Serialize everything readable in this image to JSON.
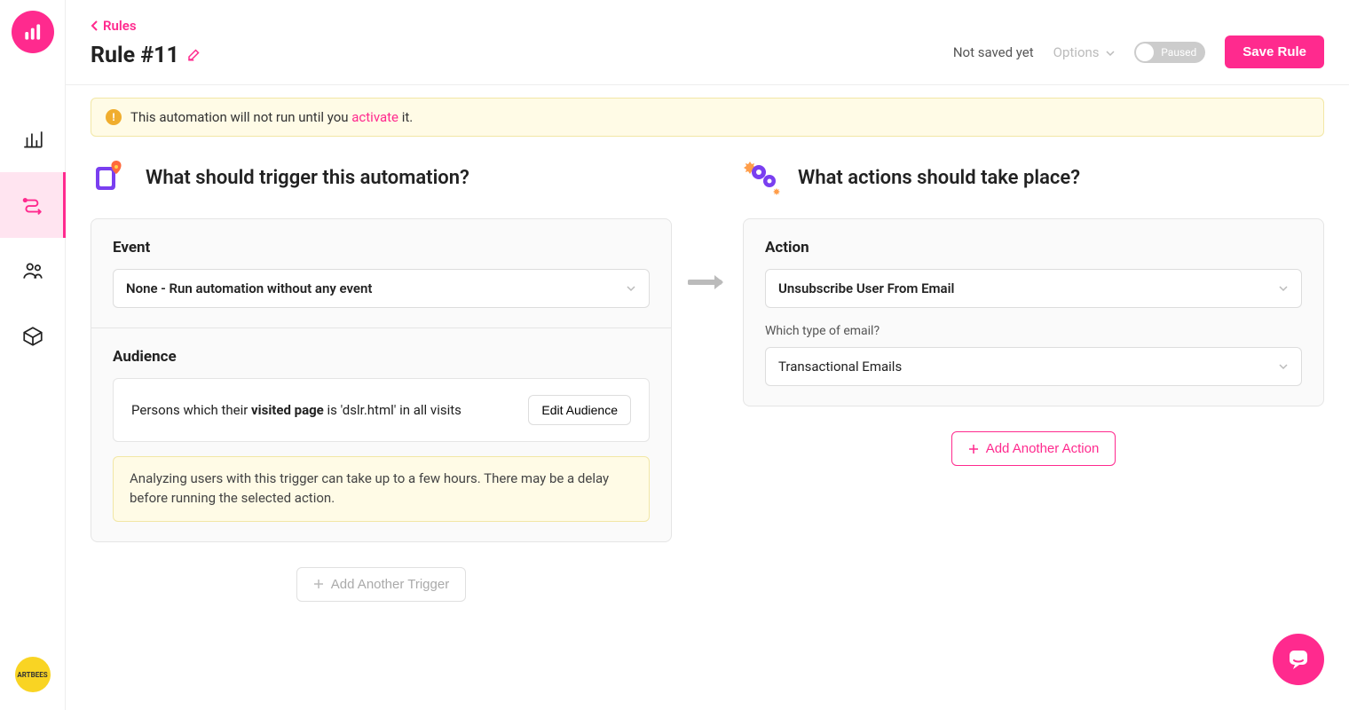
{
  "breadcrumb": "Rules",
  "title": "Rule #11",
  "header": {
    "not_saved": "Not saved yet",
    "options": "Options",
    "toggle_label": "Paused",
    "save_label": "Save Rule"
  },
  "warning": {
    "prefix": "This automation will not run until you ",
    "link": "activate",
    "suffix": " it."
  },
  "trigger": {
    "heading": "What should trigger this automation?",
    "event_label": "Event",
    "event_value": "None - Run automation without any event",
    "audience_label": "Audience",
    "audience_text_prefix": "Persons which their ",
    "audience_text_bold": "visited page",
    "audience_text_suffix": " is 'dslr.html' in all visits",
    "edit_audience": "Edit Audience",
    "delay_note": "Analyzing users with this trigger can take up to a few hours. There may be a delay before running the selected action.",
    "add_trigger": "Add Another Trigger"
  },
  "action": {
    "heading": "What actions should take place?",
    "action_label": "Action",
    "action_value": "Unsubscribe User From Email",
    "email_type_label": "Which type of email?",
    "email_type_value": "Transactional Emails",
    "add_action": "Add Another Action"
  },
  "avatar_label": "ARTBEES"
}
